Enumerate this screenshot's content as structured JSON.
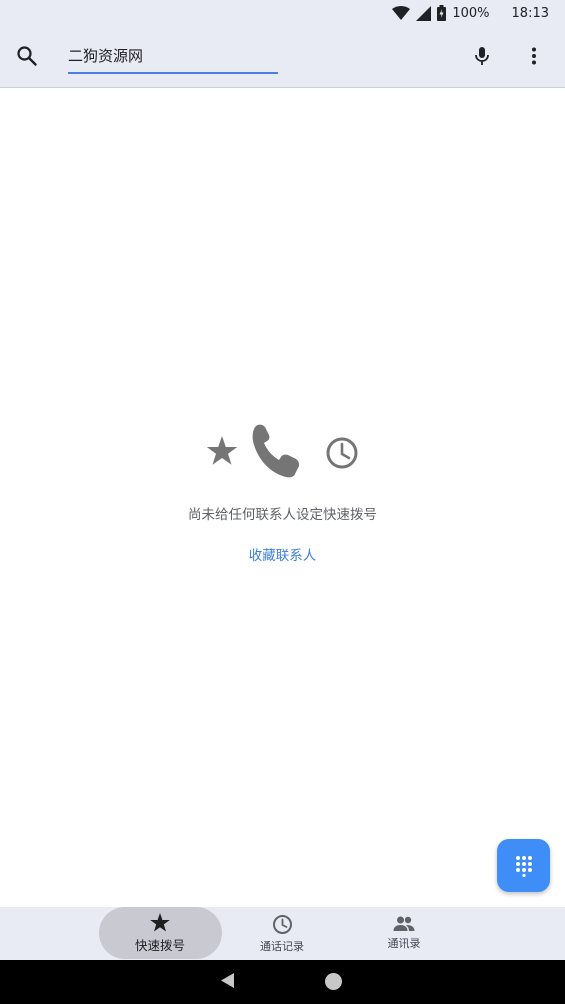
{
  "status_bar": {
    "battery": "100%",
    "time": "18:13",
    "icons": [
      "wifi-icon",
      "signal-icon",
      "battery-icon"
    ]
  },
  "search": {
    "value": "二狗资源网",
    "icons": [
      "search-icon",
      "mic-icon",
      "more-vert-icon"
    ]
  },
  "empty_state": {
    "icons": [
      "star-icon",
      "phone-icon",
      "clock-icon"
    ],
    "message": "尚未给任何联系人设定快速拨号",
    "action": "收藏联系人"
  },
  "fab": {
    "icon": "dialpad-icon",
    "color": "#3f8df7"
  },
  "bottom_nav": {
    "items": [
      {
        "label": "快速拨号",
        "icon": "star-icon",
        "active": true
      },
      {
        "label": "通话记录",
        "icon": "clock-icon",
        "active": false
      },
      {
        "label": "通讯录",
        "icon": "people-icon",
        "active": false
      }
    ]
  },
  "system_nav": {
    "icons": [
      "back-icon",
      "home-icon"
    ]
  },
  "colors": {
    "accent": "#3d7fd9",
    "surface": "#e8eaf4",
    "active_pill": "#c9c9d1"
  }
}
